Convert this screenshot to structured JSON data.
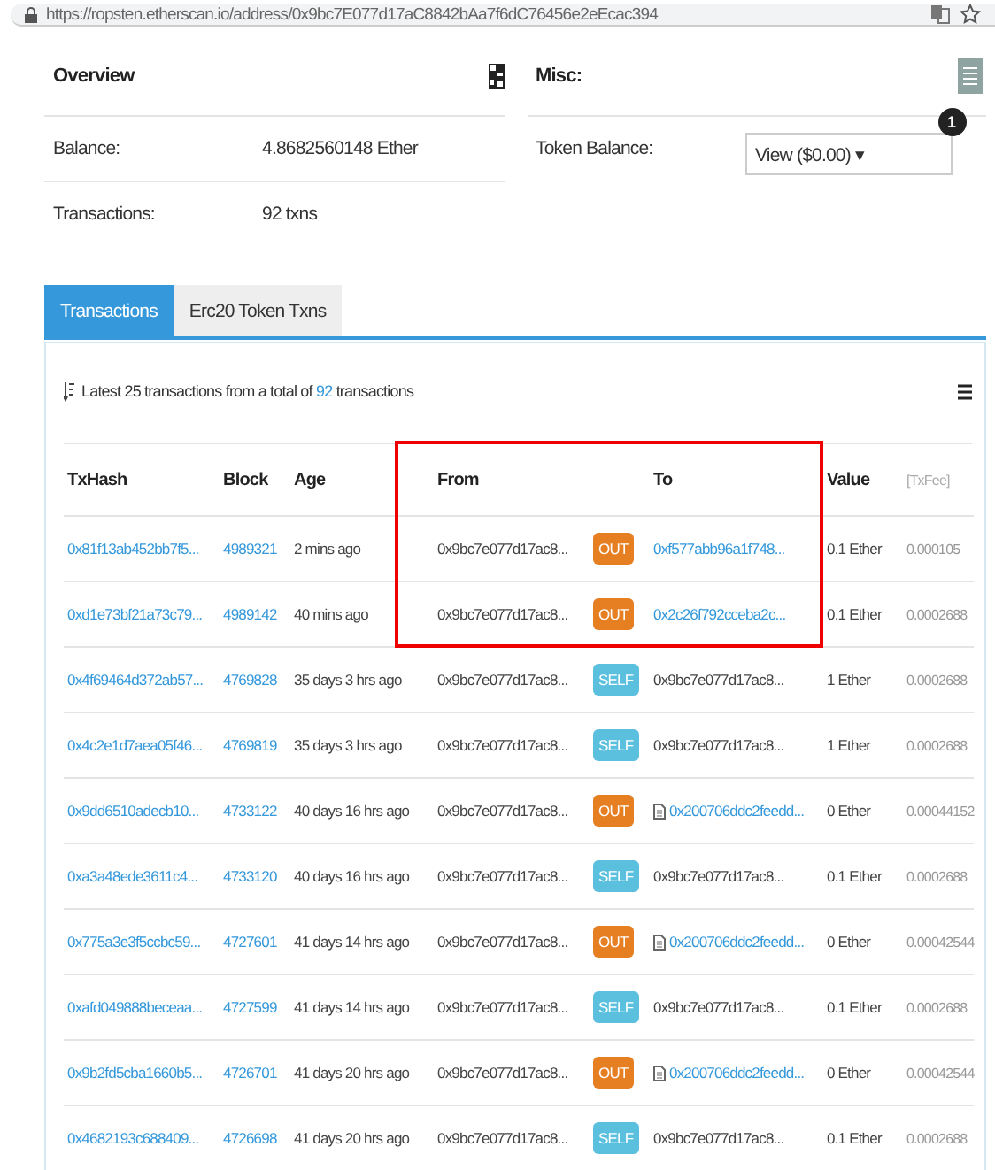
{
  "address_bar": {
    "url": "https://ropsten.etherscan.io/address/0x9bc7E077d17aC8842bAa7f6dC76456e2eEcac394"
  },
  "overview": {
    "title": "Overview",
    "fields": [
      {
        "label": "Balance:",
        "value": "4.8682560148 Ether"
      },
      {
        "label": "Transactions:",
        "value": "92 txns"
      }
    ]
  },
  "misc": {
    "title": "Misc:",
    "token_label": "Token Balance:",
    "token_select": "View ($0.00) ▾",
    "token_count": "1"
  },
  "tabs": [
    {
      "label": "Transactions",
      "selected": true
    },
    {
      "label": "Erc20 Token Txns",
      "selected": false
    }
  ],
  "summary": {
    "before": "Latest 25 transactions from a total of",
    "count": "92",
    "after": "transactions"
  },
  "table": {
    "columns": [
      "TxHash",
      "Block",
      "Age",
      "From",
      "To",
      "Value",
      "[TxFee]"
    ],
    "rows": [
      {
        "hash": "0x81f13ab452bb7f5...",
        "block": "4989321",
        "age": "2 mins ago",
        "from": "0x9bc7e077d17ac8...",
        "badge": {
          "kind": "out",
          "text": "OUT"
        },
        "to": {
          "kind": "link",
          "contract": false,
          "text": "0xf577abb96a1f748..."
        },
        "value": "0.1 Ether",
        "fee": "0.000105",
        "highlighted": true
      },
      {
        "hash": "0xd1e73bf21a73c79...",
        "block": "4989142",
        "age": "40 mins ago",
        "from": "0x9bc7e077d17ac8...",
        "badge": {
          "kind": "out",
          "text": "OUT"
        },
        "to": {
          "kind": "link",
          "contract": false,
          "text": "0x2c26f792cceba2c..."
        },
        "value": "0.1 Ether",
        "fee": "0.0002688",
        "highlighted": true
      },
      {
        "hash": "0x4f69464d372ab57...",
        "block": "4769828",
        "age": "35 days 3 hrs ago",
        "from": "0x9bc7e077d17ac8...",
        "badge": {
          "kind": "self",
          "text": "SELF"
        },
        "to": {
          "kind": "plain",
          "contract": false,
          "text": "0x9bc7e077d17ac8..."
        },
        "value": "1 Ether",
        "fee": "0.0002688",
        "highlighted": false
      },
      {
        "hash": "0x4c2e1d7aea05f46...",
        "block": "4769819",
        "age": "35 days 3 hrs ago",
        "from": "0x9bc7e077d17ac8...",
        "badge": {
          "kind": "self",
          "text": "SELF"
        },
        "to": {
          "kind": "plain",
          "contract": false,
          "text": "0x9bc7e077d17ac8..."
        },
        "value": "1 Ether",
        "fee": "0.0002688",
        "highlighted": false
      },
      {
        "hash": "0x9dd6510adecb10...",
        "block": "4733122",
        "age": "40 days 16 hrs ago",
        "from": "0x9bc7e077d17ac8...",
        "badge": {
          "kind": "out",
          "text": "OUT"
        },
        "to": {
          "kind": "link",
          "contract": true,
          "text": "0x200706ddc2feedd..."
        },
        "value": "0 Ether",
        "fee": "0.00044152",
        "highlighted": false
      },
      {
        "hash": "0xa3a48ede3611c4...",
        "block": "4733120",
        "age": "40 days 16 hrs ago",
        "from": "0x9bc7e077d17ac8...",
        "badge": {
          "kind": "self",
          "text": "SELF"
        },
        "to": {
          "kind": "plain",
          "contract": false,
          "text": "0x9bc7e077d17ac8..."
        },
        "value": "0.1 Ether",
        "fee": "0.0002688",
        "highlighted": false
      },
      {
        "hash": "0x775a3e3f5ccbc59...",
        "block": "4727601",
        "age": "41 days 14 hrs ago",
        "from": "0x9bc7e077d17ac8...",
        "badge": {
          "kind": "out",
          "text": "OUT"
        },
        "to": {
          "kind": "link",
          "contract": true,
          "text": "0x200706ddc2feedd..."
        },
        "value": "0 Ether",
        "fee": "0.00042544",
        "highlighted": false
      },
      {
        "hash": "0xafd049888beceaa...",
        "block": "4727599",
        "age": "41 days 14 hrs ago",
        "from": "0x9bc7e077d17ac8...",
        "badge": {
          "kind": "self",
          "text": "SELF"
        },
        "to": {
          "kind": "plain",
          "contract": false,
          "text": "0x9bc7e077d17ac8..."
        },
        "value": "0.1 Ether",
        "fee": "0.0002688",
        "highlighted": false
      },
      {
        "hash": "0x9b2fd5cba1660b5...",
        "block": "4726701",
        "age": "41 days 20 hrs ago",
        "from": "0x9bc7e077d17ac8...",
        "badge": {
          "kind": "out",
          "text": "OUT"
        },
        "to": {
          "kind": "link",
          "contract": true,
          "text": "0x200706ddc2feedd..."
        },
        "value": "0 Ether",
        "fee": "0.00042544",
        "highlighted": false
      },
      {
        "hash": "0x4682193c688409...",
        "block": "4726698",
        "age": "41 days 20 hrs ago",
        "from": "0x9bc7e077d17ac8...",
        "badge": {
          "kind": "self",
          "text": "SELF"
        },
        "to": {
          "kind": "plain",
          "contract": false,
          "text": "0x9bc7e077d17ac8..."
        },
        "value": "0.1 Ether",
        "fee": "0.0002688",
        "highlighted": false
      }
    ]
  }
}
